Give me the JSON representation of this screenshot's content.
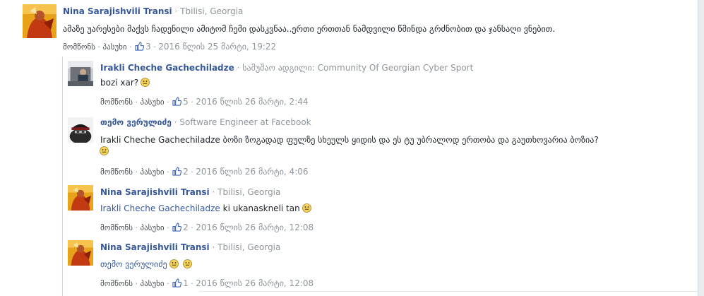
{
  "comments": [
    {
      "author": "Nina Sarajishvili Transi",
      "subtitle": "Tbilisi, Georgia",
      "text": "ამაზე უარესები მაქვს ჩადენილი ამიტომ ჩემი დასკვნაა..ერთი ერთთან ნამდვილი წმინდა გრძნობით და ჯანსაღი ვნებით.",
      "like_label": "მომწონს",
      "reply_label": "პასუხი",
      "likes": "3",
      "time": "2016 წლის 25 მარტი, 19:22"
    }
  ],
  "replies": [
    {
      "author": "Irakli Cheche Gachechiladze",
      "subtitle": "სამუშაო ადგილი: Community Of Georgian Cyber Sport",
      "text": "bozi xar?",
      "like_label": "მომწონს",
      "reply_label": "პასუხი",
      "likes": "5",
      "time": "2016 წლის 26 მარტი, 2:44"
    },
    {
      "author": "თემო ვერულიძე",
      "subtitle": "Software Engineer at Facebook",
      "text": "Irakli Cheche Gachechiladze ბოზი ზოგადად ფულზე სხეულს ყიდის და ეს ტუ უბრალოდ ერთობა და გაუთხოვარია ბოზია?",
      "like_label": "მომწონს",
      "reply_label": "პასუხი",
      "likes": "2",
      "time": "2016 წლის 26 მარტი, 4:06"
    },
    {
      "author": "Nina Sarajishvili Transi",
      "subtitle": "Tbilisi, Georgia",
      "mention": "Irakli Cheche Gachechiladze",
      "text": "ki ukanaskneli tan",
      "like_label": "მომწონს",
      "reply_label": "პასუხი",
      "likes": "2",
      "time": "2016 წლის 26 მარტი, 12:08"
    },
    {
      "author": "Nina Sarajishvili Transi",
      "subtitle": "Tbilisi, Georgia",
      "mention": "თემო ვერულიძე",
      "like_label": "მომწონს",
      "reply_label": "პასუხი",
      "likes": "1",
      "time": "2016 წლის 26 მარტი, 12:08"
    }
  ],
  "separator": "·",
  "colors": {
    "link": "#365899",
    "meta": "#90949c",
    "text": "#1d2129"
  }
}
